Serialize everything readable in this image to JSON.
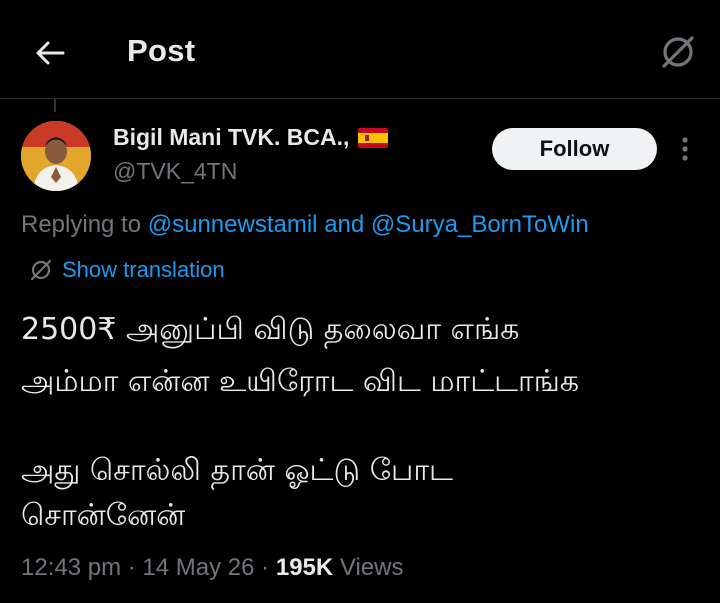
{
  "header": {
    "title": "Post",
    "back_icon": "arrow-left-icon",
    "grok_icon": "grok-icon"
  },
  "author": {
    "name": "Bigil Mani TVK. BCA.,",
    "flag": "spain-flag",
    "handle": "@TVK_4TN",
    "follow_label": "Follow",
    "more_icon": "more-vertical-icon"
  },
  "reply": {
    "prefix": "Replying to",
    "mention_1": "@sunnewstamil",
    "and_word": "and",
    "mention_2": "@Surya_BornToWin"
  },
  "translation": {
    "label": "Show translation",
    "icon": "grok-icon"
  },
  "post": {
    "line_1": "2500₹ அனுப்பி விடு தலைவா எங்க",
    "line_2": "அம்மா என்ன உயிரோட விட மாட்டாங்க",
    "line_3": "அது சொல்லி தான் ஓட்டு போட",
    "line_4": "சொன்னேன்"
  },
  "meta": {
    "time": "12:43 pm",
    "sep_1": "·",
    "date": "14 May 26",
    "sep_2": "·",
    "views_count": "195K",
    "views_label": "Views"
  },
  "colors": {
    "background": "#000000",
    "text": "#e7e9ea",
    "secondary": "#71767b",
    "accent": "#1d9bf0",
    "follow_bg": "#eff3f4"
  }
}
